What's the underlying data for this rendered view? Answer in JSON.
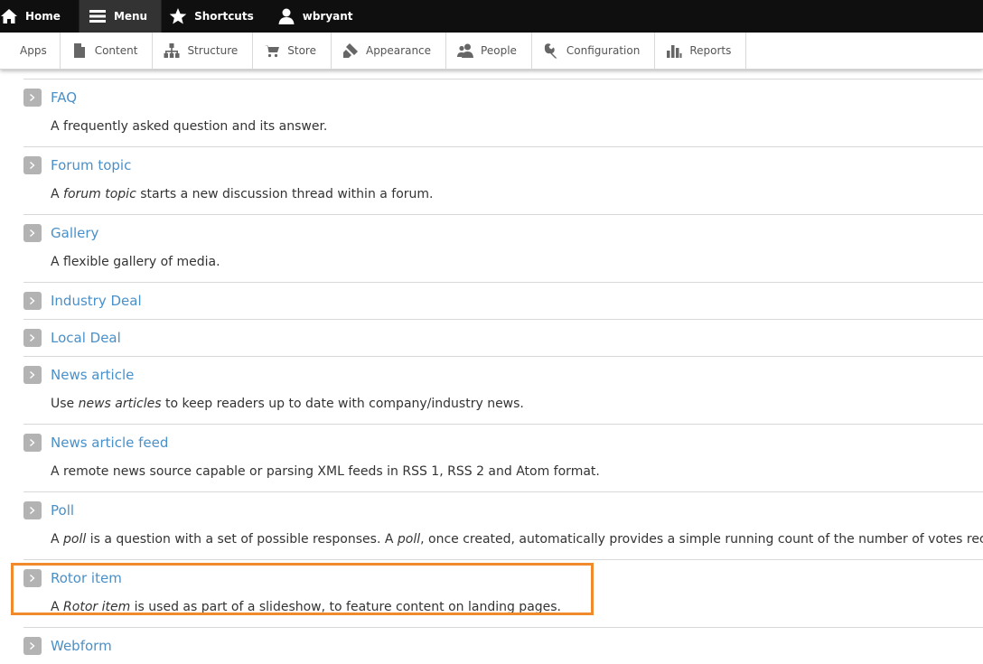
{
  "toolbar": {
    "home_label": "Home",
    "menu_label": "Menu",
    "shortcuts_label": "Shortcuts",
    "user_label": "wbryant"
  },
  "tray": {
    "items": [
      {
        "label": "Apps",
        "icon": "none"
      },
      {
        "label": "Content",
        "icon": "document-icon"
      },
      {
        "label": "Structure",
        "icon": "structure-icon"
      },
      {
        "label": "Store",
        "icon": "cart-icon"
      },
      {
        "label": "Appearance",
        "icon": "paintbrush-icon"
      },
      {
        "label": "People",
        "icon": "people-icon"
      },
      {
        "label": "Configuration",
        "icon": "wrench-icon"
      },
      {
        "label": "Reports",
        "icon": "bar-chart-icon"
      }
    ]
  },
  "content_types": [
    {
      "title": "FAQ",
      "desc_pre": "A frequently asked question and its answer.",
      "desc_em": "",
      "desc_post": ""
    },
    {
      "title": "Forum topic",
      "desc_pre": "A ",
      "desc_em": "forum topic",
      "desc_post": " starts a new discussion thread within a forum."
    },
    {
      "title": "Gallery",
      "desc_pre": "A flexible gallery of media.",
      "desc_em": "",
      "desc_post": ""
    },
    {
      "title": "Industry Deal",
      "desc_pre": "",
      "desc_em": "",
      "desc_post": ""
    },
    {
      "title": "Local Deal",
      "desc_pre": "",
      "desc_em": "",
      "desc_post": ""
    },
    {
      "title": "News article",
      "desc_pre": "Use ",
      "desc_em": "news articles",
      "desc_post": " to keep readers up to date with company/industry news."
    },
    {
      "title": "News article feed",
      "desc_pre": "A remote news source capable or parsing XML feeds in RSS 1, RSS 2 and Atom format.",
      "desc_em": "",
      "desc_post": ""
    },
    {
      "title": "Poll",
      "desc_pre": "A ",
      "desc_em": "poll",
      "desc_post": " is a question with a set of possible responses. A ",
      "desc_em2": "poll",
      "desc_post2": ", once created, automatically provides a simple running count of the number of votes receiv"
    },
    {
      "title": "Rotor item",
      "desc_pre": "A ",
      "desc_em": "Rotor item",
      "desc_post": " is used as part of a slideshow, to feature content on landing pages."
    },
    {
      "title": "Webform",
      "desc_pre": "",
      "desc_em": "",
      "desc_post": ""
    }
  ],
  "colors": {
    "link": "#4a90c8",
    "highlight": "#f08a2c",
    "toolbar_bg": "#0f0f0f"
  }
}
